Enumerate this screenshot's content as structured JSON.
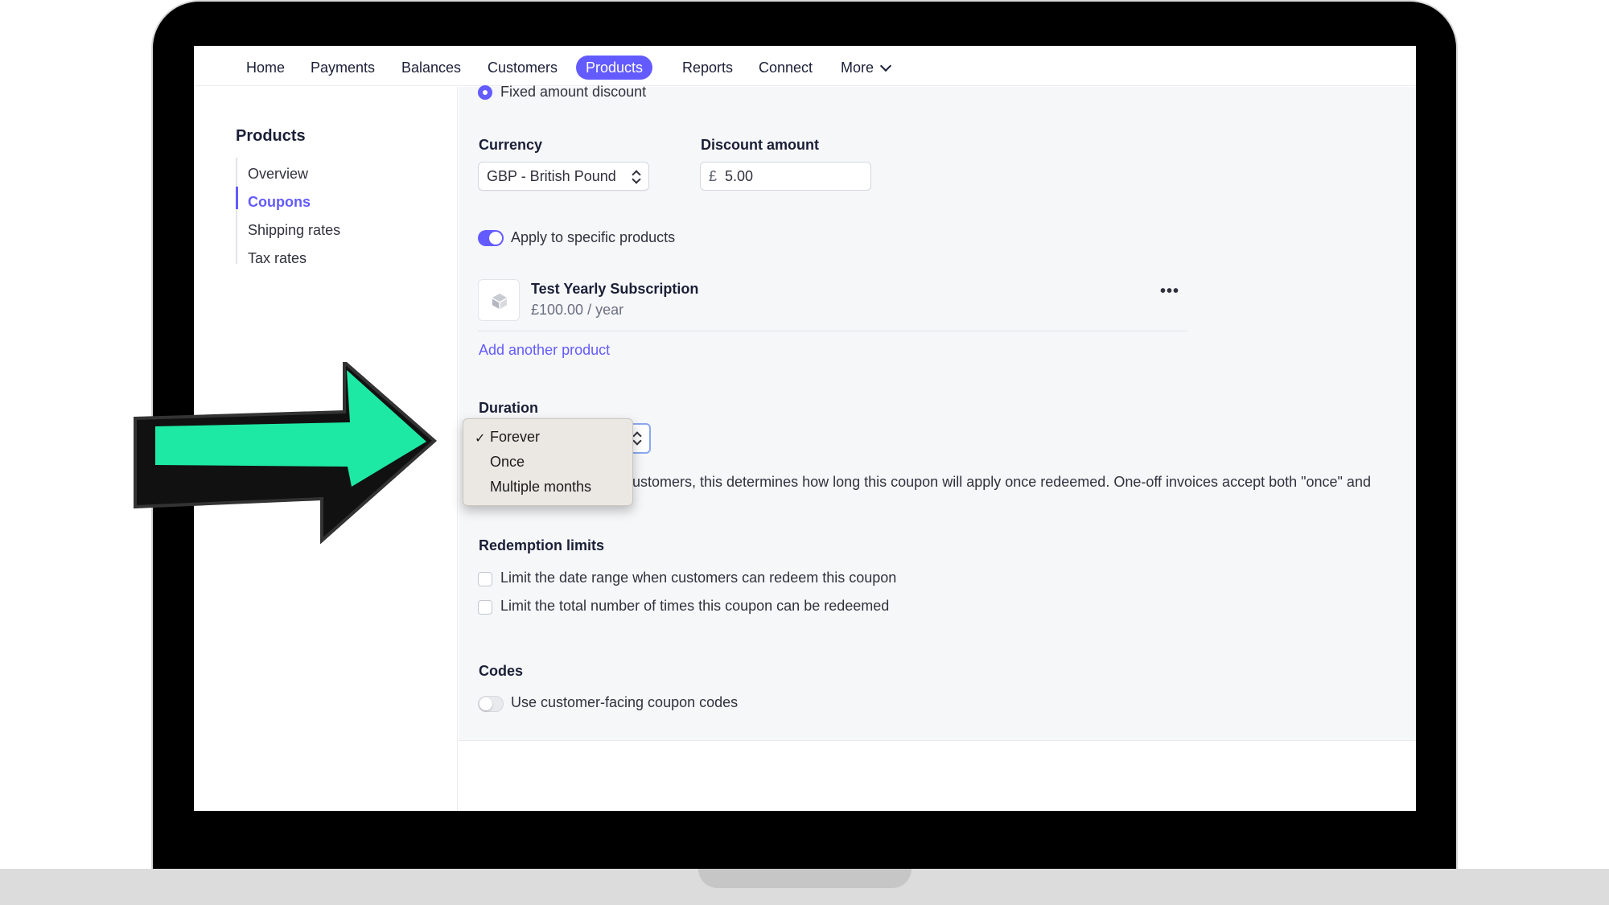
{
  "nav": {
    "items": [
      "Home",
      "Payments",
      "Balances",
      "Customers",
      "Products",
      "Reports",
      "Connect",
      "More"
    ],
    "active": "Products"
  },
  "sidebar": {
    "title": "Products",
    "items": [
      "Overview",
      "Coupons",
      "Shipping rates",
      "Tax rates"
    ],
    "active": "Coupons"
  },
  "form": {
    "type_option": "Fixed amount discount",
    "currency": {
      "label": "Currency",
      "value": "GBP - British Pound"
    },
    "discount": {
      "label": "Discount amount",
      "symbol": "£",
      "value": "5.00"
    },
    "apply_products": {
      "label": "Apply to specific products",
      "enabled": true
    },
    "product": {
      "name": "Test Yearly Subscription",
      "price": "£100.00 / year",
      "menu": "•••"
    },
    "add_product_link": "Add another product",
    "duration": {
      "label": "Duration",
      "options": [
        "Forever",
        "Once",
        "Multiple months"
      ],
      "selected": "Forever",
      "check": "✓",
      "help": "ustomers, this determines how long this coupon will apply once redeemed. One-off invoices accept both \"once\" and"
    },
    "redemption": {
      "label": "Redemption limits",
      "options": [
        "Limit the date range when customers can redeem this coupon",
        "Limit the total number of times this coupon can be redeemed"
      ]
    },
    "codes": {
      "label": "Codes",
      "toggle_label": "Use customer-facing coupon codes",
      "enabled": false
    }
  },
  "colors": {
    "accent": "#635bff",
    "arrow": "#1de9a4"
  }
}
